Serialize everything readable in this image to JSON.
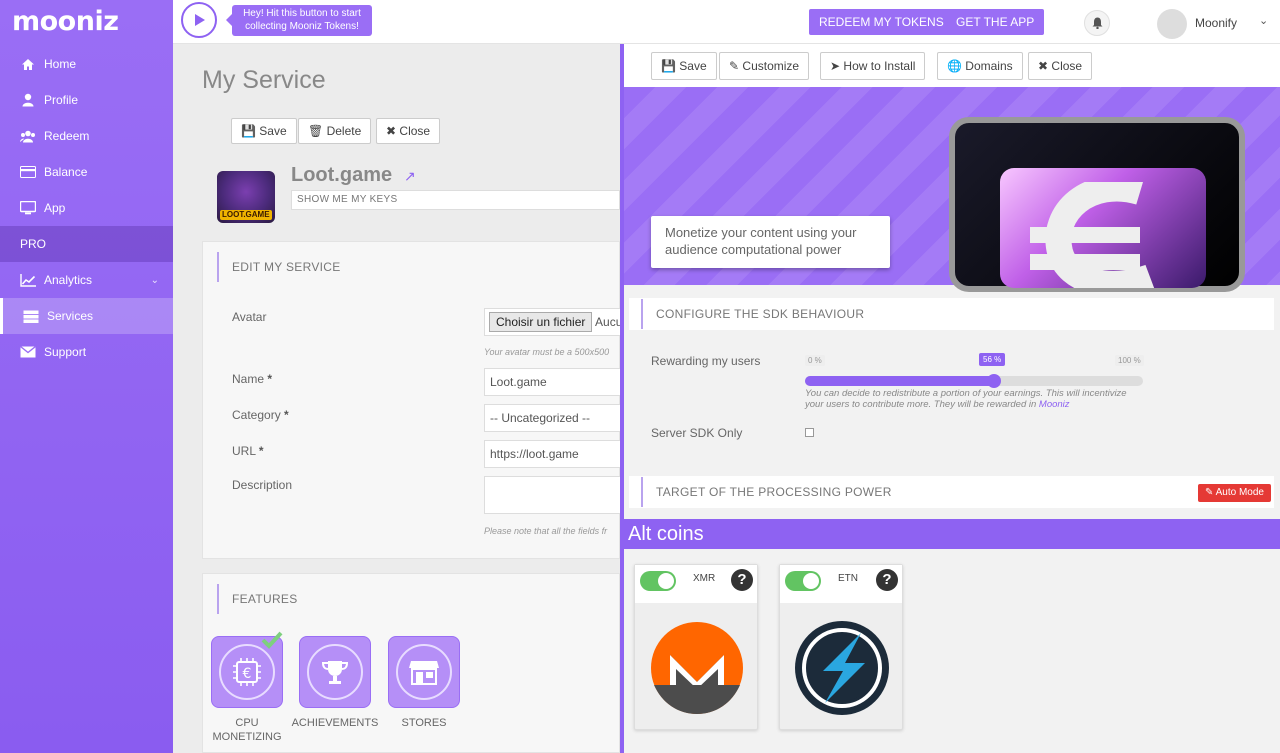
{
  "app": {
    "logo": "mooniz"
  },
  "sidebar": {
    "items": [
      {
        "label": "Home",
        "icon": "home-icon"
      },
      {
        "label": "Profile",
        "icon": "user-icon"
      },
      {
        "label": "Redeem",
        "icon": "users-icon"
      },
      {
        "label": "Balance",
        "icon": "card-icon"
      },
      {
        "label": "App",
        "icon": "monitor-icon"
      }
    ],
    "pro": "PRO",
    "analytics": "Analytics",
    "services": "Services",
    "support": "Support"
  },
  "topbar": {
    "tip": "Hey! Hit this button to start collecting Mooniz Tokens!",
    "redeem": "REDEEM MY TOKENS",
    "getapp": "GET THE APP",
    "user": "Moonify"
  },
  "page": {
    "title": "My Service",
    "save": "Save",
    "delete": "Delete",
    "close": "Close",
    "service_name": "Loot.game",
    "service_logo_text": "LOOT.GAME",
    "keys": "SHOW ME MY KEYS",
    "edit_heading": "EDIT MY SERVICE",
    "avatar_label": "Avatar",
    "file_btn": "Choisir un fichier",
    "file_status": "Aucu",
    "avatar_hint": "Your avatar must be a 500x500",
    "name_label": "Name",
    "name_value": "Loot.game",
    "category_label": "Category",
    "category_value": "-- Uncategorized --",
    "url_label": "URL",
    "url_value": "https://loot.game",
    "desc_label": "Description",
    "req": "*",
    "fields_hint": "Please note that all the fields fr",
    "features_heading": "FEATURES",
    "features": [
      "CPU MONETIZING",
      "ACHIEVEMENTS",
      "STORES"
    ]
  },
  "panel": {
    "save": "Save",
    "customize": "Customize",
    "install": "How to Install",
    "domains": "Domains",
    "close": "Close",
    "hero_text": "Monetize your content using your audience computational power",
    "cfg_heading": "CONFIGURE THE SDK BEHAVIOUR",
    "reward_label": "Rewarding my users",
    "min": "0 %",
    "max": "100 %",
    "val": "56 %",
    "reward_value": 56,
    "reward_hint1": "You can decide to redistribute a portion of your earnings. This will incentivize",
    "reward_hint2": "your users to contribute more. They will be rewarded in ",
    "reward_link": "Mooniz",
    "server_label": "Server SDK Only",
    "target_heading": "TARGET OF THE PROCESSING POWER",
    "auto": "Auto Mode",
    "alt_heading": "Alt coins",
    "coins": [
      {
        "name": "XMR"
      },
      {
        "name": "ETN"
      }
    ]
  },
  "colors": {
    "accent": "#8e62f2",
    "sidebar": "#9a6ef5",
    "danger": "#e53935",
    "toggle": "#62c462"
  }
}
